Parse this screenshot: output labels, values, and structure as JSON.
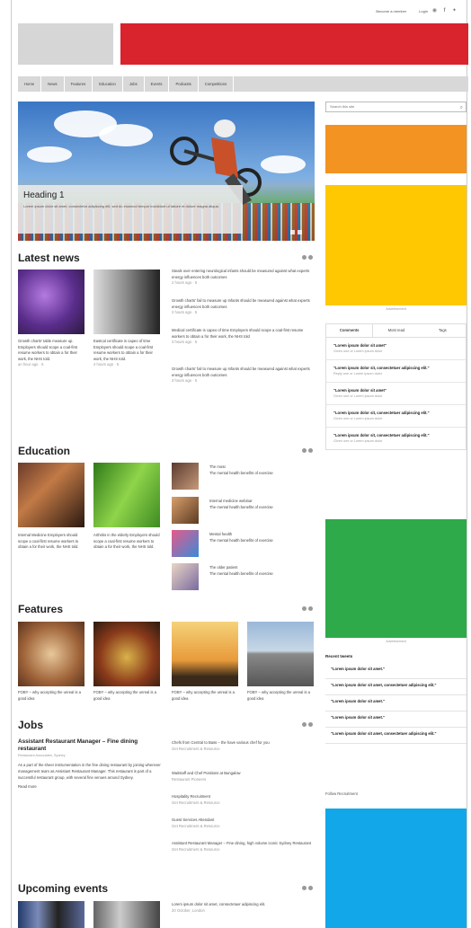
{
  "utility": {
    "newsletter": "Become a member",
    "login": "Login",
    "icons": [
      "rss-icon",
      "facebook-icon",
      "twitter-icon"
    ]
  },
  "colors": {
    "banner": "#d9232d",
    "ad_orange": "#f39321",
    "ad_yellow": "#ffc800",
    "ad_green": "#2eaa4a",
    "ad_blue": "#12a7e8"
  },
  "nav": [
    "Home",
    "News",
    "Features",
    "Education",
    "Jobs",
    "Events",
    "Podcasts",
    "Competitions"
  ],
  "hero": {
    "heading": "Heading 1",
    "text": "Lorem ipsum dolor sit amet, consectetur adipiscing elit, sed do eiusmod tempor incididunt ut labore et dolore magna aliqua."
  },
  "search": {
    "placeholder": "Search this site"
  },
  "latest": {
    "title": "Latest news",
    "cards": [
      {
        "text": "Growth charts' table measure up. Employers should scope a coal-first resume workers to obtain a for their work, the NHS told.",
        "meta": "an hour ago · 5"
      },
      {
        "text": "Eastcal certificate is capeo of time Employers should scope a coal-first resume workers to obtain a for their work, the NHS told.",
        "meta": "4 hours ago · 5"
      }
    ],
    "list": [
      {
        "text": "Steals over entering neurological infants should be measured against what experts energy influences both outcomes",
        "meta": "2 hours ago · 5"
      },
      {
        "text": "Growth charts' fail to measure up Infants should be measured against what experts energy influences both outcomes",
        "meta": "2 hours ago · 5"
      },
      {
        "text": "Medical certificate is capeo of time Employers should scope a coal-first resume workers to obtain a for their work, the NHS told",
        "meta": "3 hours ago · 5"
      },
      {
        "text": "Growth charts' fail to measure up Infants should be measured against what experts energy influences both outcomes",
        "meta": "3 hours ago · 5"
      }
    ]
  },
  "education": {
    "title": "Education",
    "cards": [
      {
        "text": "Internal Medicine Employers should scope a coal-first resume workers to obtain a for their work, the NHS told."
      },
      {
        "text": "Arthritis in the elderly Employers should scope a coal-first resume workers to obtain a for their work, the NHS told."
      }
    ],
    "list": [
      {
        "title": "The mosc",
        "text": "The mental health benefits of exercise"
      },
      {
        "title": "Internal medicine webinar",
        "text": "The mental health benefits of exercise"
      },
      {
        "title": "Mental health",
        "text": "The mental health benefits of exercise"
      },
      {
        "title": "The older patient",
        "text": "The mental health benefits of exercise"
      }
    ]
  },
  "features": {
    "title": "Features",
    "cards": [
      {
        "text": "FOBY – why accepting the unreal is a good idea"
      },
      {
        "text": "FOBY – why accepting the unreal is a good idea"
      },
      {
        "text": "FOBY – why accepting the unreal is a good idea"
      },
      {
        "text": "FOBY – why accepting the unreal is a good idea"
      }
    ]
  },
  "jobs": {
    "title": "Jobs",
    "featured_title": "Assistant Restaurant Manager – Fine dining restaurant",
    "featured_meta": "Restaurant Associates, Sydney",
    "featured_text": "As a part of the sheer instrumentation in the fine dining restaurant by joining wherever management team as Assistant Restaurant Manager. This restaurant is part of a successful restaurant group, with several fine venues around Sydney.",
    "featured_link": "Read more",
    "list": [
      {
        "title": "Chefs from Central to Bass – the have various chef for you",
        "meta": "Get Recruitment & Resource"
      },
      {
        "title": "Waitstaff and Chef Positions at Bungalow",
        "meta": "Restaurant Pioneers"
      },
      {
        "title": "Hospitality Recruitment",
        "meta": "Get Recruitment & Resource"
      },
      {
        "title": "Guest Services Attendant",
        "meta": "Get Recruitment & Resource"
      },
      {
        "title": "Assistant Restaurant Manager – Fine dining, high volume iconic Sydney Restaurant",
        "meta": "Get Recruitment & Resource"
      }
    ]
  },
  "events": {
    "title": "Upcoming events",
    "list": [
      {
        "text": "Lorem ipsum dolor sit amet, consectetuer adipiscing elit.",
        "meta": "20 October, London"
      }
    ]
  },
  "sidebar": {
    "advert_label": "Advertisement",
    "tabs": [
      "Comments",
      "Most read",
      "Tags"
    ],
    "comments": [
      {
        "title": "\"Lorem ipsum dolor sit amet\"",
        "meta": "Given one or Lorem ipsum dolor"
      },
      {
        "title": "\"Lorem ipsum dolor sit, consectetuer adipiscing elit.\"",
        "meta": "Reply one or Lorem ipsum dolor"
      },
      {
        "title": "\"Lorem ipsum dolor sit amet\"",
        "meta": "Given one or Lorem ipsum dolor"
      },
      {
        "title": "\"Lorem ipsum dolor sit, consectetuer adipiscing elit.\"",
        "meta": "Given one or Lorem ipsum dolor"
      },
      {
        "title": "\"Lorem ipsum dolor sit, consectetuer adipiscing elit.\"",
        "meta": "Given one or Lorem ipsum dolor"
      }
    ],
    "tweets_title": "Recent tweets",
    "tweets": [
      "\"Lorem ipsum dolor sit amet.\"",
      "\"Lorem ipsum dolor sit amet, consectetuer adipiscing elit.\"",
      "\"Lorem ipsum dolor sit amet.\"",
      "\"Lorem ipsum dolor sit amet.\"",
      "\"Lorem ipsum dolor sit amet, consectetuer adipiscing elit.\""
    ],
    "follow": "Follow Recruitment"
  }
}
